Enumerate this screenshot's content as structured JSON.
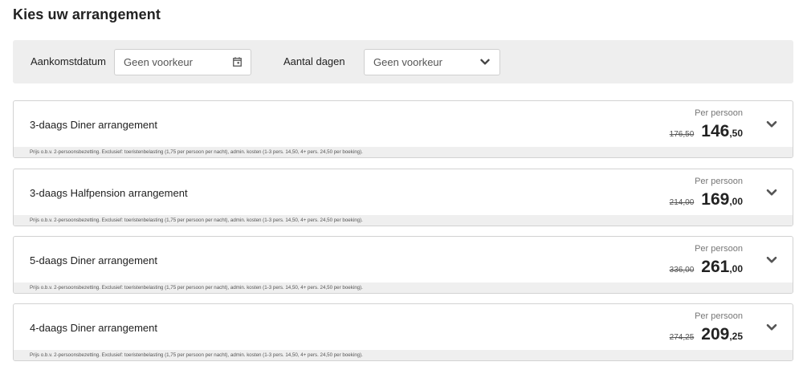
{
  "page_title": "Kies uw arrangement",
  "filters": {
    "arrival_label": "Aankomstdatum",
    "arrival_value": "Geen voorkeur",
    "days_label": "Aantal dagen",
    "days_value": "Geen voorkeur"
  },
  "packages": [
    {
      "title": "3-daags Diner arrangement",
      "price_label": "Per persoon",
      "old_price": "176,50",
      "price_int": "146",
      "price_dec": ",50",
      "note": "Prijs o.b.v. 2-persoonsbezetting. Exclusief: toeristenbelasting (1,75 per persoon per nacht), admin. kosten (1-3 pers. 14,50, 4+ pers. 24,50 per boeking)."
    },
    {
      "title": "3-daags Halfpension arrangement",
      "price_label": "Per persoon",
      "old_price": "214,00",
      "price_int": "169",
      "price_dec": ",00",
      "note": "Prijs o.b.v. 2-persoonsbezetting. Exclusief: toeristenbelasting (1,75 per persoon per nacht), admin. kosten (1-3 pers. 14,50, 4+ pers. 24,50 per boeking)."
    },
    {
      "title": "5-daags Diner arrangement",
      "price_label": "Per persoon",
      "old_price": "336,00",
      "price_int": "261",
      "price_dec": ",00",
      "note": "Prijs o.b.v. 2-persoonsbezetting. Exclusief: toeristenbelasting (1,75 per persoon per nacht), admin. kosten (1-3 pers. 14,50, 4+ pers. 24,50 per boeking)."
    },
    {
      "title": "4-daags Diner arrangement",
      "price_label": "Per persoon",
      "old_price": "274,25",
      "price_int": "209",
      "price_dec": ",25",
      "note": "Prijs o.b.v. 2-persoonsbezetting. Exclusief: toeristenbelasting (1,75 per persoon per nacht), admin. kosten (1-3 pers. 14,50, 4+ pers. 24,50 per boeking)."
    }
  ],
  "icons": {
    "calendar": "calendar-icon",
    "dropdown": "chevron-down-icon",
    "expand": "chevron-down-icon"
  },
  "colors": {
    "filter_bg": "#eeeeee",
    "card_border": "#d2d2d2",
    "chevron": "#555555"
  }
}
